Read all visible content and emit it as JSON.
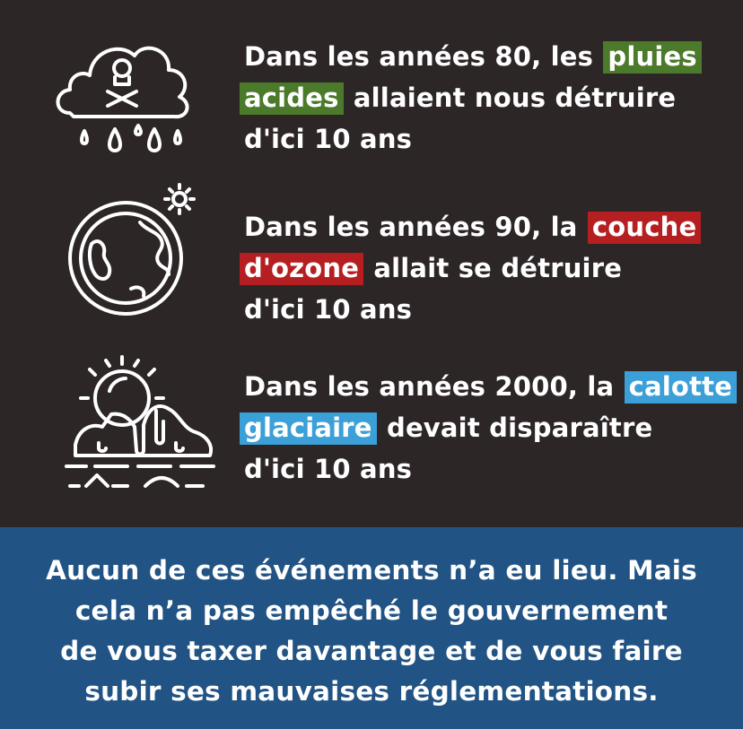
{
  "items": [
    {
      "icon": "acid-rain-cloud-icon",
      "lines": [
        {
          "before": "Dans les années 80, les ",
          "highlight": "pluies",
          "after": ""
        },
        {
          "before": "",
          "highlight": "acides",
          "after": " allaient nous détruire"
        },
        {
          "before": "d'ici 10 ans",
          "highlight": "",
          "after": ""
        }
      ],
      "highlight_color": "#4b7a2a"
    },
    {
      "icon": "ozone-earth-icon",
      "lines": [
        {
          "before": "Dans les années 90, la ",
          "highlight": "couche",
          "after": ""
        },
        {
          "before": "",
          "highlight": "d'ozone",
          "after": " allait se détruire"
        },
        {
          "before": "d'ici 10 ans",
          "highlight": "",
          "after": ""
        }
      ],
      "highlight_color": "#b51f21"
    },
    {
      "icon": "melting-ice-cap-icon",
      "lines": [
        {
          "before": "Dans les années 2000, la ",
          "highlight": "calotte",
          "after": ""
        },
        {
          "before": "",
          "highlight": "glaciaire",
          "after": " devait disparaître"
        },
        {
          "before": "d'ici 10 ans",
          "highlight": "",
          "after": ""
        }
      ],
      "highlight_color": "#3b9fd8"
    }
  ],
  "conclusion": {
    "lines": [
      "Aucun de ces événements n’a eu lieu. Mais",
      "cela n’a pas empêché le gouvernement",
      "de vous taxer davantage et de vous faire",
      "subir ses mauvaises réglementations."
    ]
  },
  "colors": {
    "background_top": "#2d2627",
    "background_bottom": "#215384",
    "text": "#ffffff"
  }
}
